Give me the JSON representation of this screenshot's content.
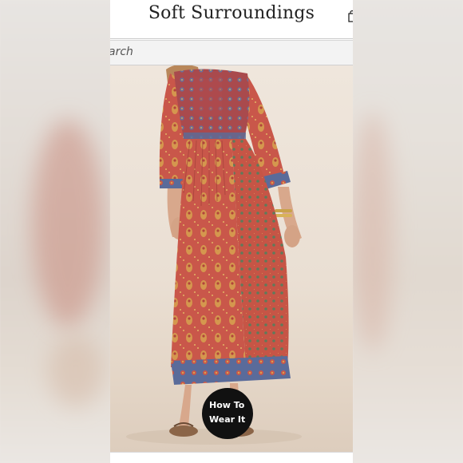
{
  "header": {
    "logo_text": "Soft Surroundings",
    "bag_icon": "shopping-bag-icon"
  },
  "search": {
    "placeholder_visible": "arch",
    "icon": "search-icon"
  },
  "product": {
    "image_alt": "woman-in-red-paisley-print-maxi-dress-back-view"
  },
  "how_to_wear": {
    "line1": "How To",
    "line2": "Wear It"
  },
  "colors": {
    "dress_red": "#c9574a",
    "paisley_gold": "#d7a24f",
    "border_blue": "#5a6b9a",
    "badge_bg": "#111111"
  }
}
